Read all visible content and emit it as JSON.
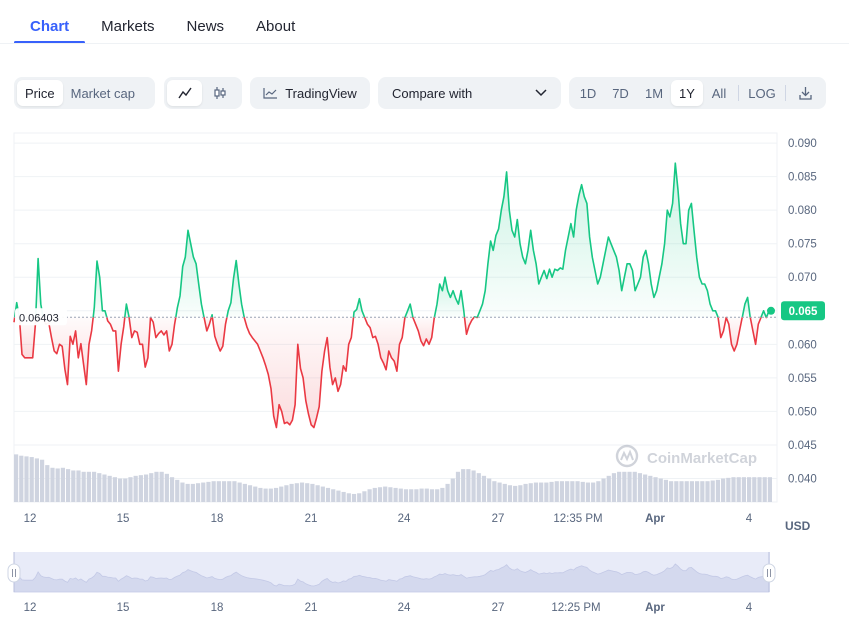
{
  "tabs": [
    "Chart",
    "Markets",
    "News",
    "About"
  ],
  "toolbar": {
    "price_label": "Price",
    "market_cap_label": "Market cap",
    "line_icon": "line-chart-icon",
    "candle_icon": "candlestick-icon",
    "tradingview_label": "TradingView",
    "compare_label": "Compare with",
    "ranges": [
      "1D",
      "7D",
      "1M",
      "1Y",
      "All"
    ],
    "active_range": "1Y",
    "log_label": "LOG",
    "download_icon": "download-icon"
  },
  "colors": {
    "accent": "#3861fb",
    "up": "#16c784",
    "down": "#ea3943"
  },
  "chart_data": {
    "type": "line",
    "y_ticks": [
      "0.090",
      "0.085",
      "0.080",
      "0.075",
      "0.070",
      "0.065",
      "0.060",
      "0.055",
      "0.050",
      "0.045",
      "0.040"
    ],
    "ylim": [
      0.0365,
      0.0915
    ],
    "x_ticks": [
      "12",
      "15",
      "18",
      "21",
      "24",
      "27",
      "12:35 PM",
      "Apr",
      "4"
    ],
    "y_unit": "USD",
    "reference_value": 0.06403,
    "reference_label": "0.06403",
    "current_value": 0.065,
    "current_label": "0.065",
    "watermark": "CoinMarketCap",
    "price_series": [
      0.0633,
      0.0662,
      0.064,
      0.0585,
      0.058,
      0.058,
      0.058,
      0.058,
      0.063,
      0.0728,
      0.066,
      0.0637,
      0.063,
      0.0632,
      0.061,
      0.059,
      0.0586,
      0.06,
      0.0597,
      0.0563,
      0.054,
      0.0612,
      0.06,
      0.062,
      0.058,
      0.0601,
      0.057,
      0.054,
      0.06,
      0.062,
      0.0655,
      0.0724,
      0.07,
      0.065,
      0.065,
      0.0635,
      0.063,
      0.062,
      0.062,
      0.056,
      0.06,
      0.0627,
      0.066,
      0.064,
      0.061,
      0.062,
      0.0618,
      0.06,
      0.06,
      0.0566,
      0.058,
      0.064,
      0.0633,
      0.061,
      0.0616,
      0.062,
      0.0614,
      0.062,
      0.059,
      0.06,
      0.063,
      0.0654,
      0.0672,
      0.0716,
      0.073,
      0.077,
      0.075,
      0.073,
      0.072,
      0.069,
      0.066,
      0.064,
      0.062,
      0.063,
      0.0644,
      0.0612,
      0.06,
      0.059,
      0.0597,
      0.063,
      0.065,
      0.0662,
      0.0698,
      0.0725,
      0.069,
      0.066,
      0.064,
      0.0626,
      0.0616,
      0.061,
      0.0605,
      0.06,
      0.059,
      0.058,
      0.0568,
      0.0555,
      0.0534,
      0.0493,
      0.0476,
      0.051,
      0.05,
      0.0482,
      0.0484,
      0.048,
      0.0487,
      0.051,
      0.06,
      0.0564,
      0.055,
      0.0516,
      0.0496,
      0.048,
      0.0476,
      0.049,
      0.0507,
      0.056,
      0.059,
      0.061,
      0.0566,
      0.054,
      0.055,
      0.053,
      0.054,
      0.0568,
      0.056,
      0.06,
      0.061,
      0.0648,
      0.0652,
      0.0668,
      0.065,
      0.064,
      0.063,
      0.0625,
      0.061,
      0.0612,
      0.06,
      0.058,
      0.0572,
      0.0562,
      0.059,
      0.058,
      0.0575,
      0.056,
      0.06,
      0.061,
      0.064,
      0.065,
      0.066,
      0.064,
      0.063,
      0.062,
      0.0605,
      0.0598,
      0.0608,
      0.06,
      0.061,
      0.064,
      0.066,
      0.069,
      0.068,
      0.07,
      0.068,
      0.067,
      0.068,
      0.0668,
      0.066,
      0.068,
      0.065,
      0.0615,
      0.0628,
      0.0636,
      0.0641,
      0.064,
      0.065,
      0.066,
      0.068,
      0.072,
      0.0754,
      0.074,
      0.0762,
      0.0772,
      0.08,
      0.082,
      0.0857,
      0.08,
      0.077,
      0.076,
      0.0786,
      0.075,
      0.073,
      0.072,
      0.074,
      0.077,
      0.074,
      0.072,
      0.069,
      0.07,
      0.071,
      0.0698,
      0.0712,
      0.07,
      0.0712,
      0.071,
      0.0714,
      0.0712,
      0.074,
      0.076,
      0.078,
      0.076,
      0.08,
      0.0822,
      0.0838,
      0.082,
      0.081,
      0.076,
      0.073,
      0.071,
      0.069,
      0.07,
      0.072,
      0.074,
      0.076,
      0.075,
      0.074,
      0.073,
      0.071,
      0.068,
      0.07,
      0.072,
      0.072,
      0.071,
      0.068,
      0.069,
      0.07,
      0.073,
      0.074,
      0.072,
      0.069,
      0.067,
      0.068,
      0.07,
      0.072,
      0.075,
      0.08,
      0.079,
      0.081,
      0.087,
      0.083,
      0.078,
      0.075,
      0.075,
      0.08,
      0.081,
      0.077,
      0.073,
      0.07,
      0.069,
      0.069,
      0.068,
      0.066,
      0.065,
      0.065,
      0.064,
      0.061,
      0.062,
      0.064,
      0.063,
      0.06,
      0.059,
      0.06,
      0.062,
      0.064,
      0.066,
      0.067,
      0.064,
      0.062,
      0.06,
      0.063,
      0.064,
      0.065,
      0.064,
      0.065
    ],
    "volume_series": [
      0.0436,
      0.0434,
      0.0433,
      0.0432,
      0.043,
      0.0428,
      0.042,
      0.0416,
      0.0415,
      0.0416,
      0.0414,
      0.0412,
      0.0412,
      0.041,
      0.041,
      0.041,
      0.0408,
      0.0406,
      0.0404,
      0.0402,
      0.04,
      0.04,
      0.0402,
      0.0404,
      0.0405,
      0.0406,
      0.0408,
      0.041,
      0.041,
      0.0407,
      0.0402,
      0.0398,
      0.0394,
      0.0392,
      0.0392,
      0.0393,
      0.0394,
      0.0395,
      0.0396,
      0.0396,
      0.0396,
      0.0396,
      0.0396,
      0.0394,
      0.0392,
      0.039,
      0.0388,
      0.0386,
      0.0385,
      0.0385,
      0.0386,
      0.0388,
      0.039,
      0.0392,
      0.0393,
      0.0394,
      0.0393,
      0.0392,
      0.039,
      0.0388,
      0.0386,
      0.0384,
      0.0382,
      0.038,
      0.0378,
      0.0377,
      0.0378,
      0.0381,
      0.0384,
      0.0386,
      0.0387,
      0.0388,
      0.0387,
      0.0386,
      0.0385,
      0.0384,
      0.0384,
      0.0384,
      0.0385,
      0.0385,
      0.0384,
      0.0384,
      0.0386,
      0.0392,
      0.04,
      0.041,
      0.0414,
      0.0414,
      0.0412,
      0.0408,
      0.0404,
      0.04,
      0.0396,
      0.0394,
      0.0392,
      0.039,
      0.0389,
      0.039,
      0.0392,
      0.0393,
      0.0394,
      0.0394,
      0.0394,
      0.0395,
      0.0396,
      0.0396,
      0.0396,
      0.0396,
      0.0396,
      0.0395,
      0.0394,
      0.0394,
      0.0396,
      0.04,
      0.0404,
      0.0408,
      0.041,
      0.041,
      0.041,
      0.041,
      0.0408,
      0.0406,
      0.0404,
      0.0402,
      0.04,
      0.0398,
      0.0396,
      0.0396,
      0.0396,
      0.0396,
      0.0396,
      0.0396,
      0.0396,
      0.0396,
      0.0397,
      0.0398,
      0.04,
      0.0401,
      0.0402,
      0.0402,
      0.0402,
      0.0402,
      0.0402,
      0.0402,
      0.0402,
      0.0402
    ],
    "navigator_x_ticks": [
      "12",
      "15",
      "18",
      "21",
      "24",
      "27",
      "12:25 PM",
      "Apr",
      "4"
    ]
  }
}
